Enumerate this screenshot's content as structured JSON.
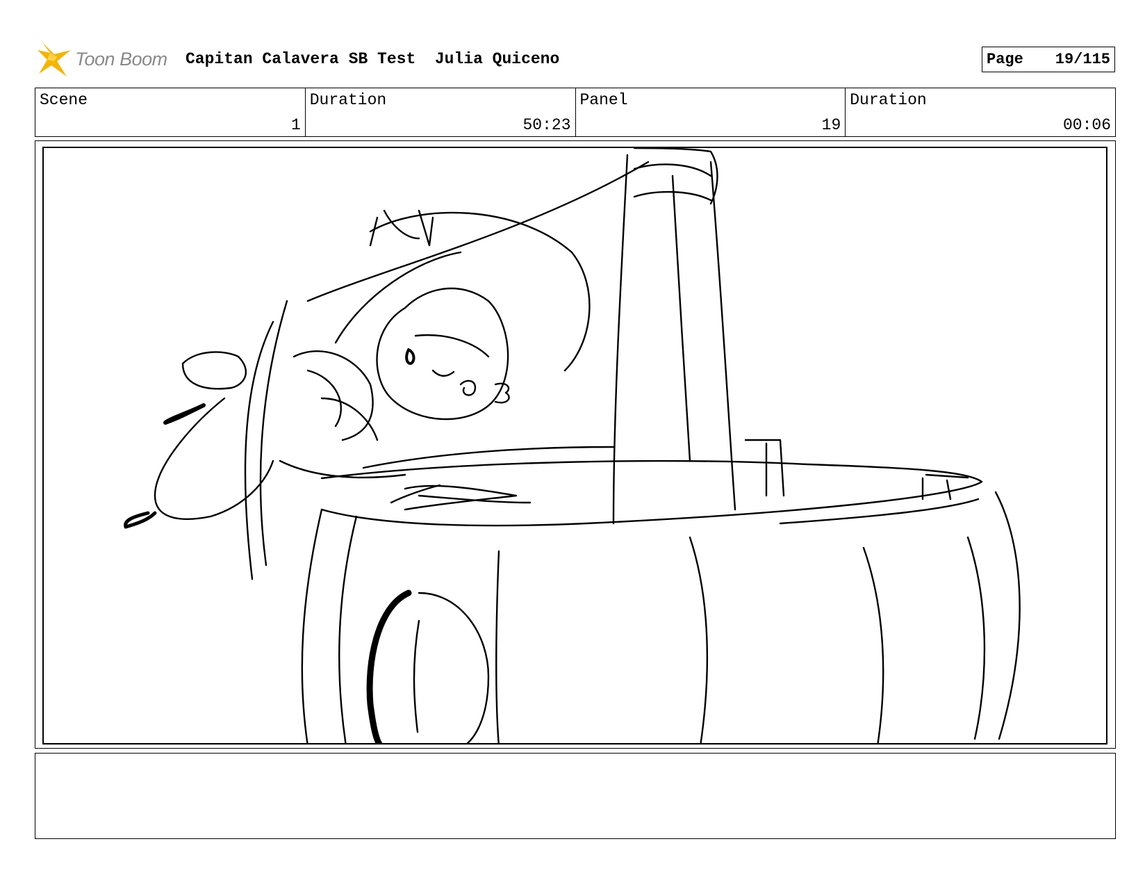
{
  "header": {
    "logo_text": "Toon Boom",
    "title": "Capitan Calavera SB Test  Julia Quiceno",
    "page_label": "Page",
    "page_value": "19/115"
  },
  "info": {
    "scene_label": "Scene",
    "scene_value": "1",
    "scene_duration_label": "Duration",
    "scene_duration_value": "50:23",
    "panel_label": "Panel",
    "panel_value": "19",
    "panel_duration_label": "Duration",
    "panel_duration_value": "00:06"
  },
  "colors": {
    "logo_star": "#f5b400",
    "logo_text": "#8a8a8a",
    "ink": "#000000"
  },
  "panel": {
    "image": "rough storyboard sketch of a character leaning over the rim of a barrel-like container"
  },
  "notes": {
    "text": ""
  }
}
